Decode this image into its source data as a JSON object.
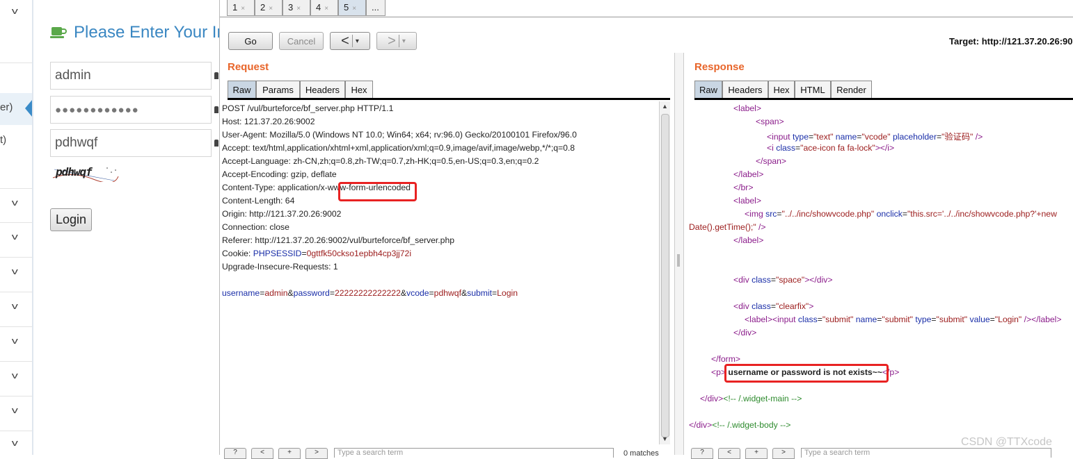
{
  "background_page": {
    "title": "Please Enter Your In",
    "username_value": "admin",
    "password_value": "●●●●●●●●●●●●",
    "vcode_value": "pdhwqf",
    "captcha_text": "pdhwqf",
    "login_label": "Login",
    "sidebar_fragments": [
      "er)",
      "t)"
    ]
  },
  "repeater": {
    "tabs": [
      {
        "label": "1",
        "close": "×"
      },
      {
        "label": "2",
        "close": "×"
      },
      {
        "label": "3",
        "close": "×"
      },
      {
        "label": "4",
        "close": "×"
      },
      {
        "label": "5",
        "close": "×"
      },
      {
        "label": "...",
        "close": ""
      }
    ],
    "go_label": "Go",
    "cancel_label": "Cancel",
    "back_label": "<",
    "forward_label": ">",
    "dropdown_glyph": "▾",
    "target": "Target: http://121.37.20.26:90",
    "request": {
      "title": "Request",
      "tabs": [
        "Raw",
        "Params",
        "Headers",
        "Hex"
      ],
      "lines": [
        "POST /vul/burteforce/bf_server.php HTTP/1.1",
        "Host: 121.37.20.26:9002",
        "User-Agent: Mozilla/5.0 (Windows NT 10.0; Win64; x64; rv:96.0) Gecko/20100101 Firefox/96.0",
        "Accept: text/html,application/xhtml+xml,application/xml;q=0.9,image/avif,image/webp,*/*;q=0.8",
        "Accept-Language: zh-CN,zh;q=0.8,zh-TW;q=0.7,zh-HK;q=0.5,en-US;q=0.3,en;q=0.2",
        "Accept-Encoding: gzip, deflate",
        "Content-Type: application/x-www-form-urlencoded",
        "Content-Length: 64",
        "Origin: http://121.37.20.26:9002",
        "Connection: close",
        "Referer: http://121.37.20.26:9002/vul/burteforce/bf_server.php"
      ],
      "cookie_prefix": "Cookie: ",
      "cookie_name": "PHPSESSID",
      "cookie_value": "0gttfk50ckso1epbh4cp3jj72i",
      "upgrade_line": "Upgrade-Insecure-Requests: 1",
      "body": {
        "k1": "username",
        "v1": "admin",
        "k2": "password",
        "v2": "22222222222222",
        "k3": "vcode",
        "v3": "pdhwqf",
        "k4": "submit",
        "v4": "Login"
      }
    },
    "response": {
      "title": "Response",
      "tabs": [
        "Raw",
        "Headers",
        "Hex",
        "HTML",
        "Render"
      ],
      "placeholder_cn": "验证码",
      "message": "username or password is not exists~~"
    },
    "bottom": {
      "search_placeholder": "Type a search term",
      "matches": "0 matches",
      "help": "?",
      "prev": "<",
      "add": "+",
      "next": ">"
    }
  },
  "watermark": "CSDN @TTXcode"
}
